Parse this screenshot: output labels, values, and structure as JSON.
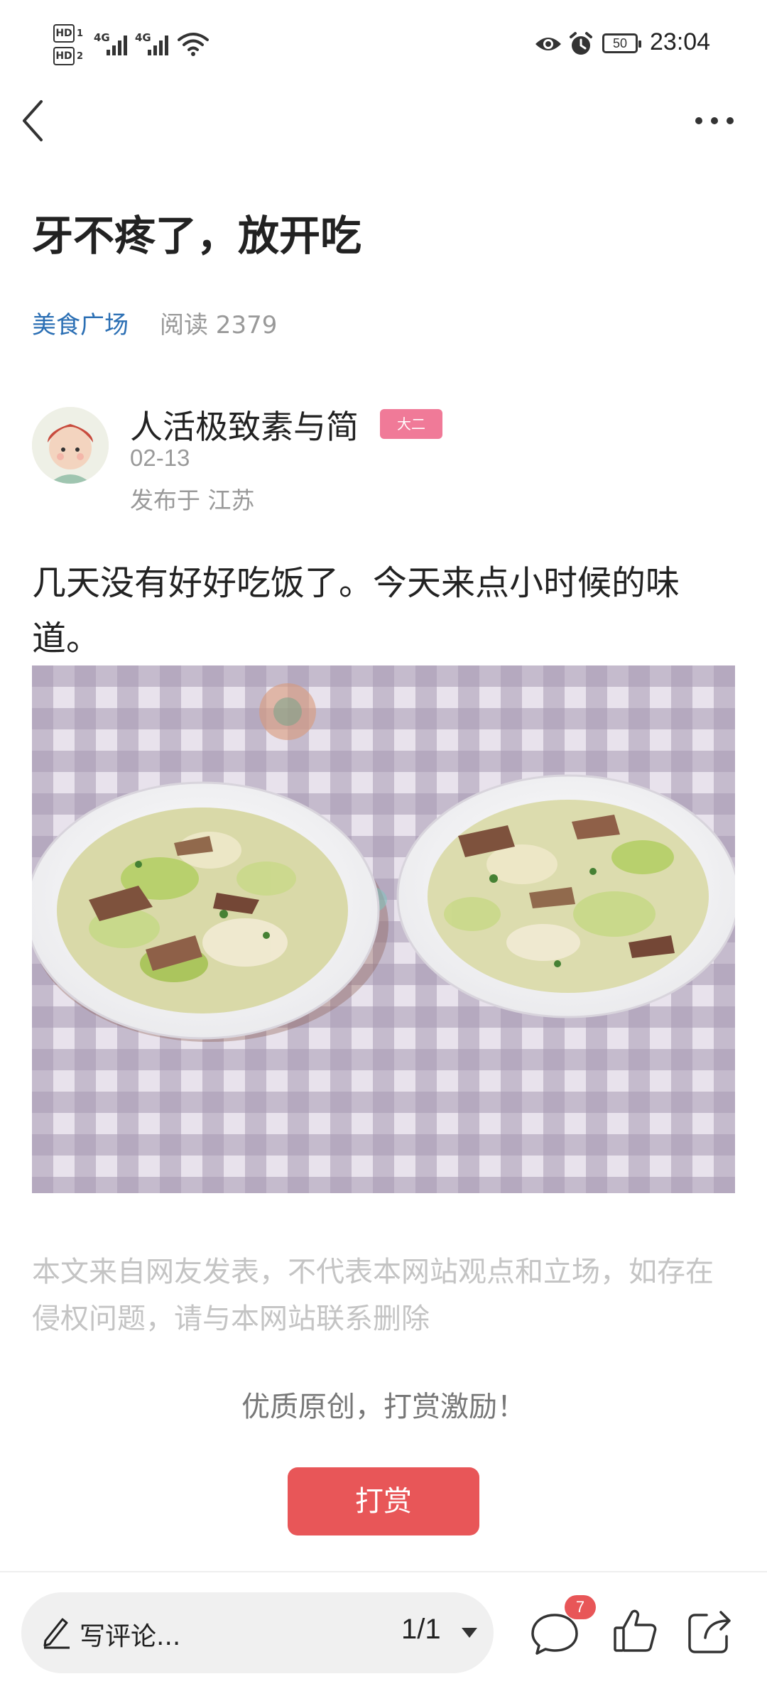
{
  "status_bar": {
    "hd1": "HD",
    "hd1_sub": "1",
    "hd2": "HD",
    "hd2_sub": "2",
    "sim1_network": "4G",
    "sim2_network": "4G",
    "battery_level": "50",
    "time": "23:04",
    "icons": [
      "signal-icon",
      "wifi-icon",
      "eye-icon",
      "alarm-icon",
      "battery-icon"
    ]
  },
  "nav": {
    "back_icon": "chevron-left-icon",
    "more_icon": "more-horizontal-icon"
  },
  "article": {
    "title": "牙不疼了，放开吃",
    "category": "美食广场",
    "reads": "阅读 2379",
    "author": {
      "name": "人活极致素与简",
      "level": "大二",
      "date": "02-13",
      "location": "发布于 江苏"
    },
    "body": "几天没有好好吃饭了。今天来点小时候的味道。"
  },
  "footer_content": {
    "disclaimer": "本文来自网友发表，不代表本网站观点和立场，如存在侵权问题，请与本网站联系删除",
    "reward_prompt": "优质原创，打赏激励！",
    "reward_button": "打赏"
  },
  "bottom_bar": {
    "comment_placeholder": "写评论...",
    "page_indicator": "1/1",
    "comment_count": "7",
    "icons": [
      "pen-icon",
      "caret-down-icon",
      "comment-icon",
      "like-icon",
      "share-icon"
    ]
  },
  "colors": {
    "accent_blue": "#2b6fb4",
    "reward_red": "#e85658",
    "badge_pink": "#f07a98"
  }
}
